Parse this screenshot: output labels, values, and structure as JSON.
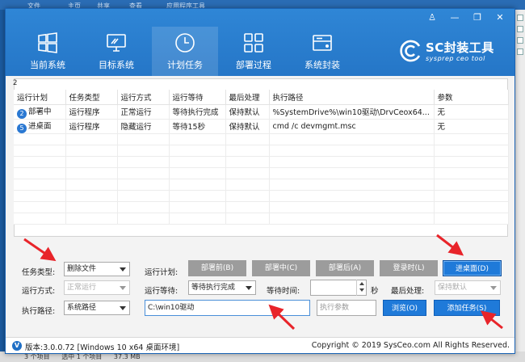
{
  "background": {
    "tabs": [
      "文件",
      "主页",
      "共享",
      "查看",
      "应用程序工具"
    ],
    "status": [
      "3 个项目",
      "选中 1 个项目",
      "37.3 MB"
    ]
  },
  "window": {
    "controls": {
      "user": "♙",
      "minimize": "—",
      "maximize": "❐",
      "close": "✕"
    }
  },
  "nav": {
    "tabs": [
      {
        "label": "当前系统",
        "icon": "windows-icon"
      },
      {
        "label": "目标系统",
        "icon": "monitor-icon"
      },
      {
        "label": "计划任务",
        "icon": "clock-icon",
        "active": true
      },
      {
        "label": "部署过程",
        "icon": "grid-icon"
      },
      {
        "label": "系统封装",
        "icon": "disk-icon"
      }
    ]
  },
  "logo": {
    "title": "SC封装工具",
    "subtitle": "sysprep ceo tool"
  },
  "task_list": {
    "count": "2",
    "columns": [
      "运行计划",
      "任务类型",
      "运行方式",
      "运行等待",
      "最后处理",
      "执行路径",
      "参数"
    ],
    "rows": [
      {
        "num": "2",
        "plan": "部署中",
        "type": "运行程序",
        "mode": "正常运行",
        "wait": "等待执行完成",
        "post": "保持默认",
        "path": "%SystemDrive%\\win10驱动\\DrvCeox64...",
        "param": "无"
      },
      {
        "num": "5",
        "plan": "进桌面",
        "type": "运行程序",
        "mode": "隐藏运行",
        "wait": "等待15秒",
        "post": "保持默认",
        "path": "cmd /c devmgmt.msc",
        "param": "无"
      }
    ]
  },
  "form": {
    "task_type_label": "任务类型:",
    "task_type_value": "删除文件",
    "run_mode_label": "运行方式:",
    "run_mode_value": "正常运行",
    "exec_path_label": "执行路径:",
    "exec_path_value": "系统路径",
    "run_plan_label": "运行计划:",
    "plan_buttons": [
      "部署前(B)",
      "部署中(C)",
      "部署后(A)",
      "登录时(L)",
      "进桌面(D)"
    ],
    "run_wait_label": "运行等待:",
    "run_wait_value": "等待执行完成",
    "wait_time_label": "等待时间:",
    "wait_time_value": "",
    "seconds_unit": "秒",
    "post_label": "最后处理:",
    "post_value": "保持默认",
    "path_input_value": "C:\\win10驱动",
    "params_placeholder": "执行参数",
    "browse_label": "浏览(O)",
    "add_task_label": "添加任务(S)"
  },
  "statusbar": {
    "version": "版本:3.0.0.72 [Windows 10 x64 桌面环境]",
    "copyright": "Copyright © 2019 SysCeo.com All Rights Reserved."
  },
  "colors": {
    "title_blue": "#2f86d6",
    "button_blue": "#1f7ad9",
    "button_gray": "#9c9c9c",
    "annotation_red": "#e8242a"
  }
}
